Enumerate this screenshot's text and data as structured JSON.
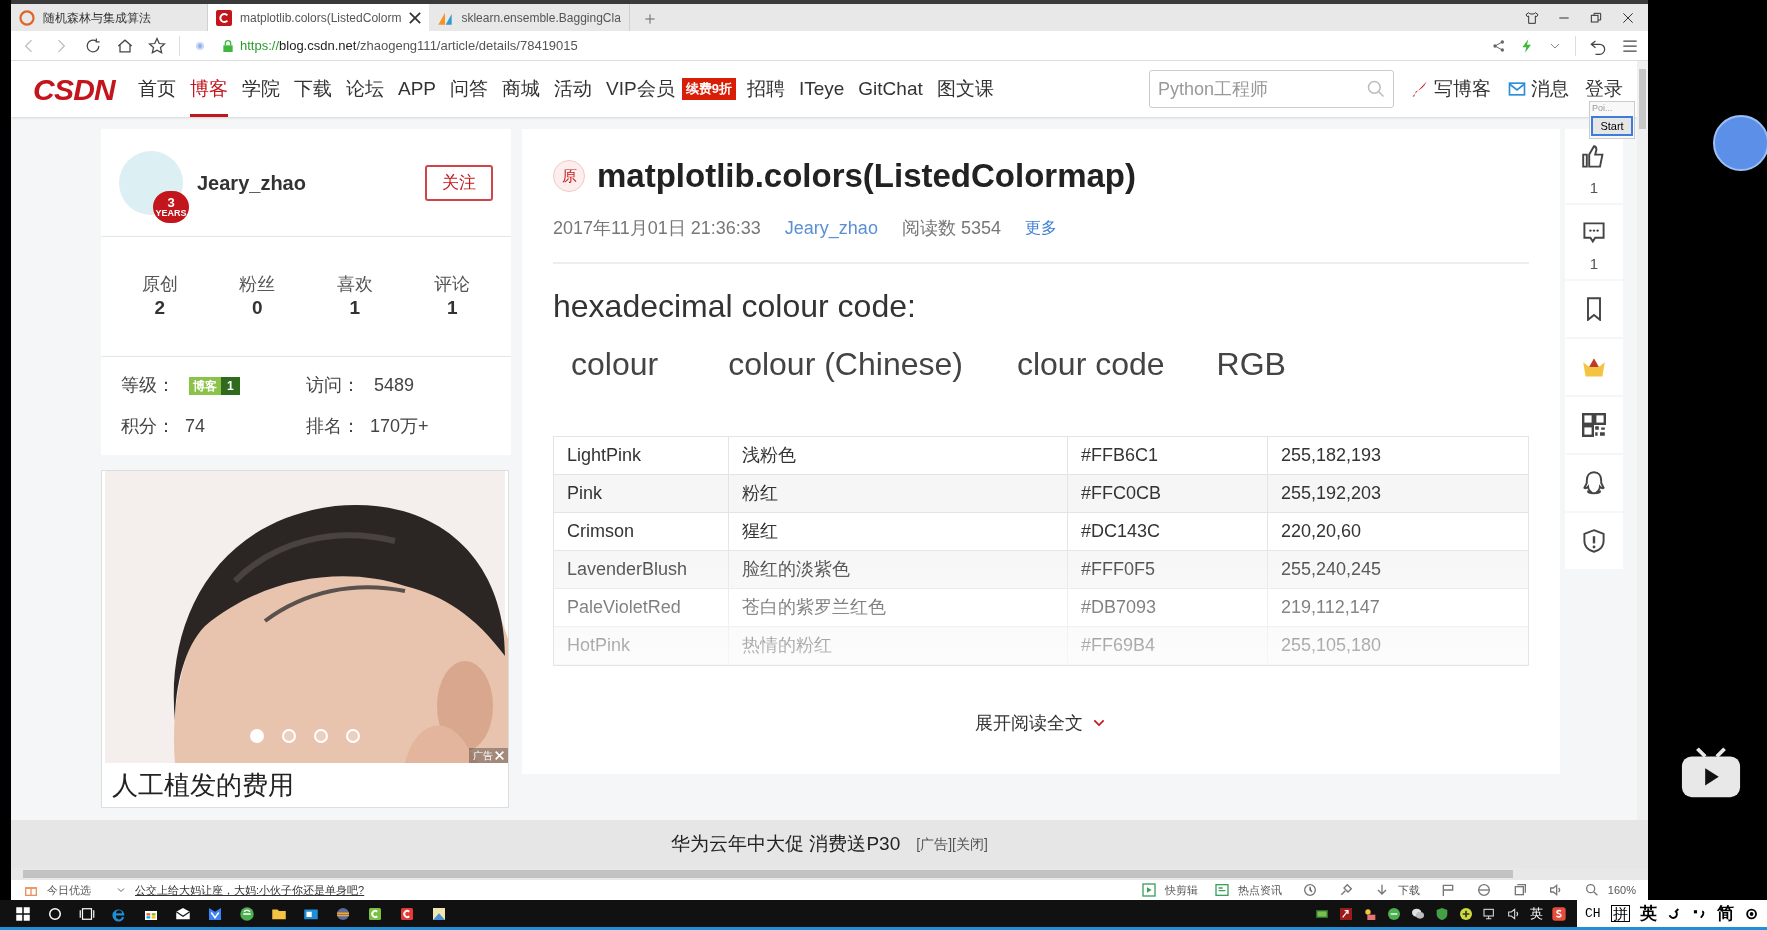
{
  "browser": {
    "tabs": [
      {
        "title": "随机森林与集成算法",
        "selected": false,
        "kind": "loading"
      },
      {
        "title": "matplotlib.colors(ListedColorm",
        "selected": true,
        "kind": "csdn"
      },
      {
        "title": "sklearn.ensemble.BaggingCla",
        "selected": false,
        "kind": "sklearn"
      }
    ],
    "url": {
      "scheme": "https://",
      "host": "blog.csdn.net",
      "path": "/zhaogeng111/article/details/78419015"
    }
  },
  "nav": {
    "logo": "CSDN",
    "items": [
      {
        "label": "首页",
        "selected": false
      },
      {
        "label": "博客",
        "selected": true
      },
      {
        "label": "学院",
        "selected": false
      },
      {
        "label": "下载",
        "selected": false
      },
      {
        "label": "论坛",
        "selected": false
      },
      {
        "label": "APP",
        "selected": false
      },
      {
        "label": "问答",
        "selected": false
      },
      {
        "label": "商城",
        "selected": false
      },
      {
        "label": "活动",
        "selected": false
      },
      {
        "label": "VIP会员",
        "selected": false,
        "badge": "续费9折"
      },
      {
        "label": "招聘",
        "selected": false
      },
      {
        "label": "ITeye",
        "selected": false
      },
      {
        "label": "GitChat",
        "selected": false
      },
      {
        "label": "图文课",
        "selected": false
      }
    ],
    "search": {
      "placeholder": "Python工程师"
    },
    "actions": [
      {
        "label": "写博客",
        "kind": "write"
      },
      {
        "label": "消息",
        "kind": "mail"
      },
      {
        "label": "登录",
        "kind": "plain"
      }
    ]
  },
  "popup": {
    "title": "Poi...",
    "button": "Start"
  },
  "profile": {
    "name": "Jeary_zhao",
    "badge_number": "3",
    "badge_text": "YEARS",
    "follow": "关注",
    "stats": [
      {
        "label": "原创",
        "value": "2"
      },
      {
        "label": "粉丝",
        "value": "0"
      },
      {
        "label": "喜欢",
        "value": "1"
      },
      {
        "label": "评论",
        "value": "1"
      }
    ],
    "level_label": "等级：",
    "level_badge": "博客",
    "level_number": "1",
    "visits_label": "访问：",
    "visits": "5489",
    "points_label": "积分：",
    "points": "74",
    "rank_label": "排名：",
    "rank": "170万+"
  },
  "ad": {
    "caption": "人工植发的费用",
    "label": "广告",
    "dots": [
      {
        "selected": true
      },
      {
        "selected": false
      },
      {
        "selected": false
      },
      {
        "selected": false
      }
    ]
  },
  "article": {
    "mark": "原",
    "title": "matplotlib.colors(ListedColormap)",
    "date": "2017年11月01日 21:36:33",
    "author": "Jeary_zhao",
    "reads": "阅读数 5354",
    "more": "更多",
    "heading": "hexadecimal colour code:",
    "columns": [
      "colour",
      "colour (Chinese)",
      "clour code",
      "RGB"
    ],
    "rows": [
      {
        "colour": "LightPink",
        "chinese": "浅粉色",
        "code": "#FFB6C1",
        "rgb": "255,182,193"
      },
      {
        "colour": "Pink",
        "chinese": "粉红",
        "code": "#FFC0CB",
        "rgb": "255,192,203"
      },
      {
        "colour": "Crimson",
        "chinese": "猩红",
        "code": "#DC143C",
        "rgb": "220,20,60"
      },
      {
        "colour": "LavenderBlush",
        "chinese": "脸红的淡紫色",
        "code": "#FFF0F5",
        "rgb": "255,240,245"
      },
      {
        "colour": "PaleVioletRed",
        "chinese": "苍白的紫罗兰红色",
        "code": "#DB7093",
        "rgb": "219,112,147"
      },
      {
        "colour": "HotPink",
        "chinese": "热情的粉红",
        "code": "#FF69B4",
        "rgb": "255,105,180"
      }
    ],
    "expand": "展开阅读全文"
  },
  "rail": [
    {
      "kind": "like",
      "count": "1"
    },
    {
      "kind": "comment",
      "count": "1"
    },
    {
      "kind": "bookmark"
    },
    {
      "kind": "vip"
    },
    {
      "kind": "qr"
    },
    {
      "kind": "qq"
    },
    {
      "kind": "report"
    }
  ],
  "bottom_ad": {
    "text": "华为云年中大促 消费送P30",
    "links": "[广告][关闭]"
  },
  "status_bar": {
    "left": "今日优选",
    "news": "公交上给大妈让座，大妈:小伙子你还是单身吧?",
    "clip": "快剪辑",
    "hot": "热点资讯",
    "download": "下载",
    "zoom": "160%"
  },
  "taskbar": {
    "tray_lang": "英",
    "ime": [
      "CH",
      "拼",
      "英",
      "简"
    ]
  }
}
